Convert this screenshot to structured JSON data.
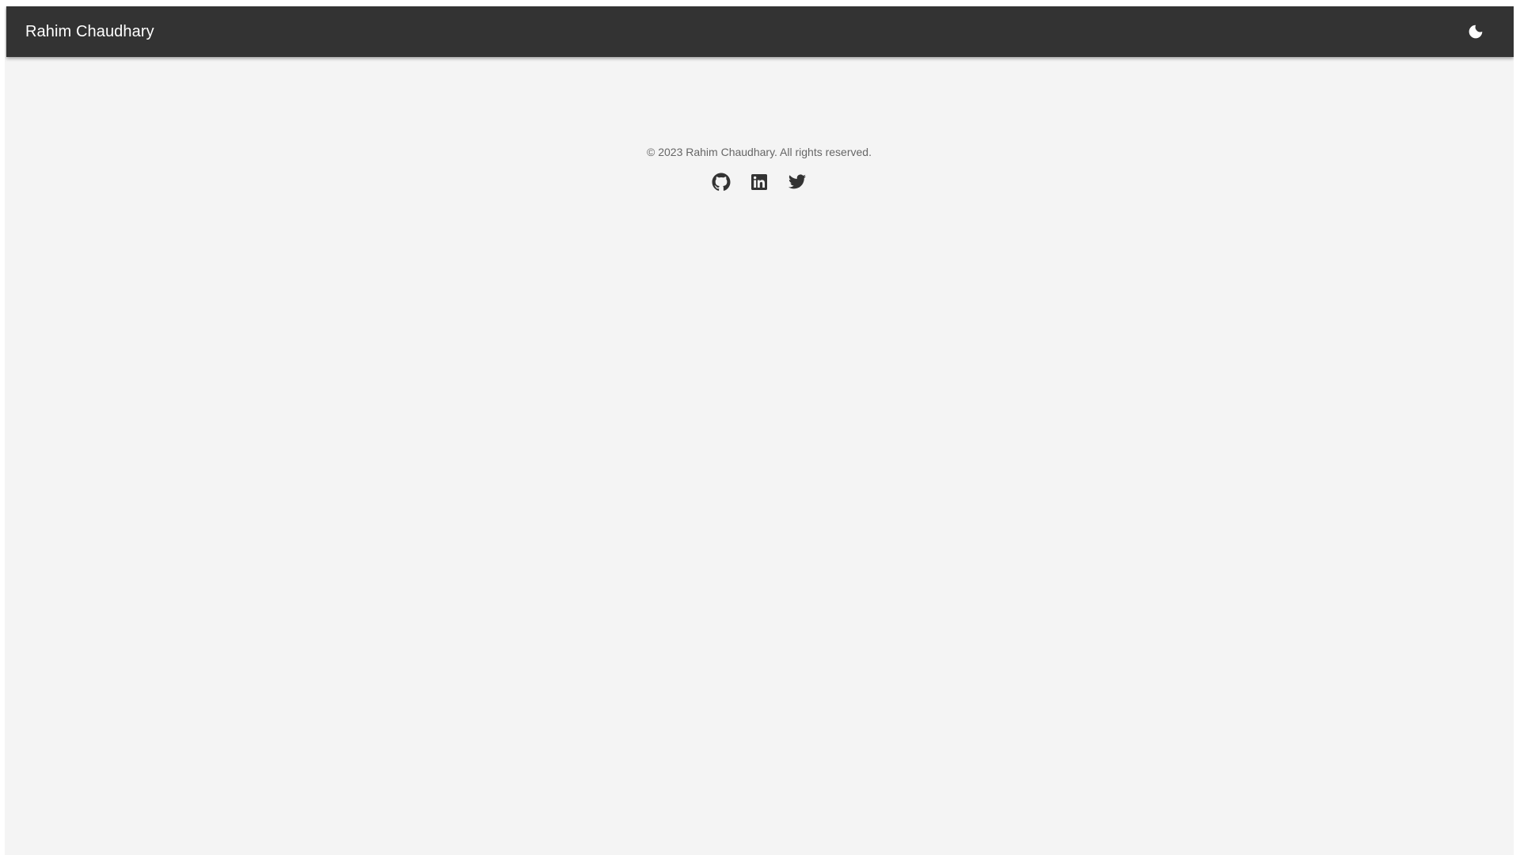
{
  "header": {
    "title": "Rahim Chaudhary",
    "theme_toggle_icon": "moon-icon"
  },
  "footer": {
    "copyright": "© 2023 Rahim Chaudhary. All rights reserved.",
    "social_links": [
      {
        "icon": "github-icon"
      },
      {
        "icon": "linkedin-icon"
      },
      {
        "icon": "twitter-icon"
      }
    ]
  },
  "colors": {
    "app_bar": "#333333",
    "background": "#f4f4f4",
    "icon": "#333333",
    "footer_text": "#666666"
  }
}
